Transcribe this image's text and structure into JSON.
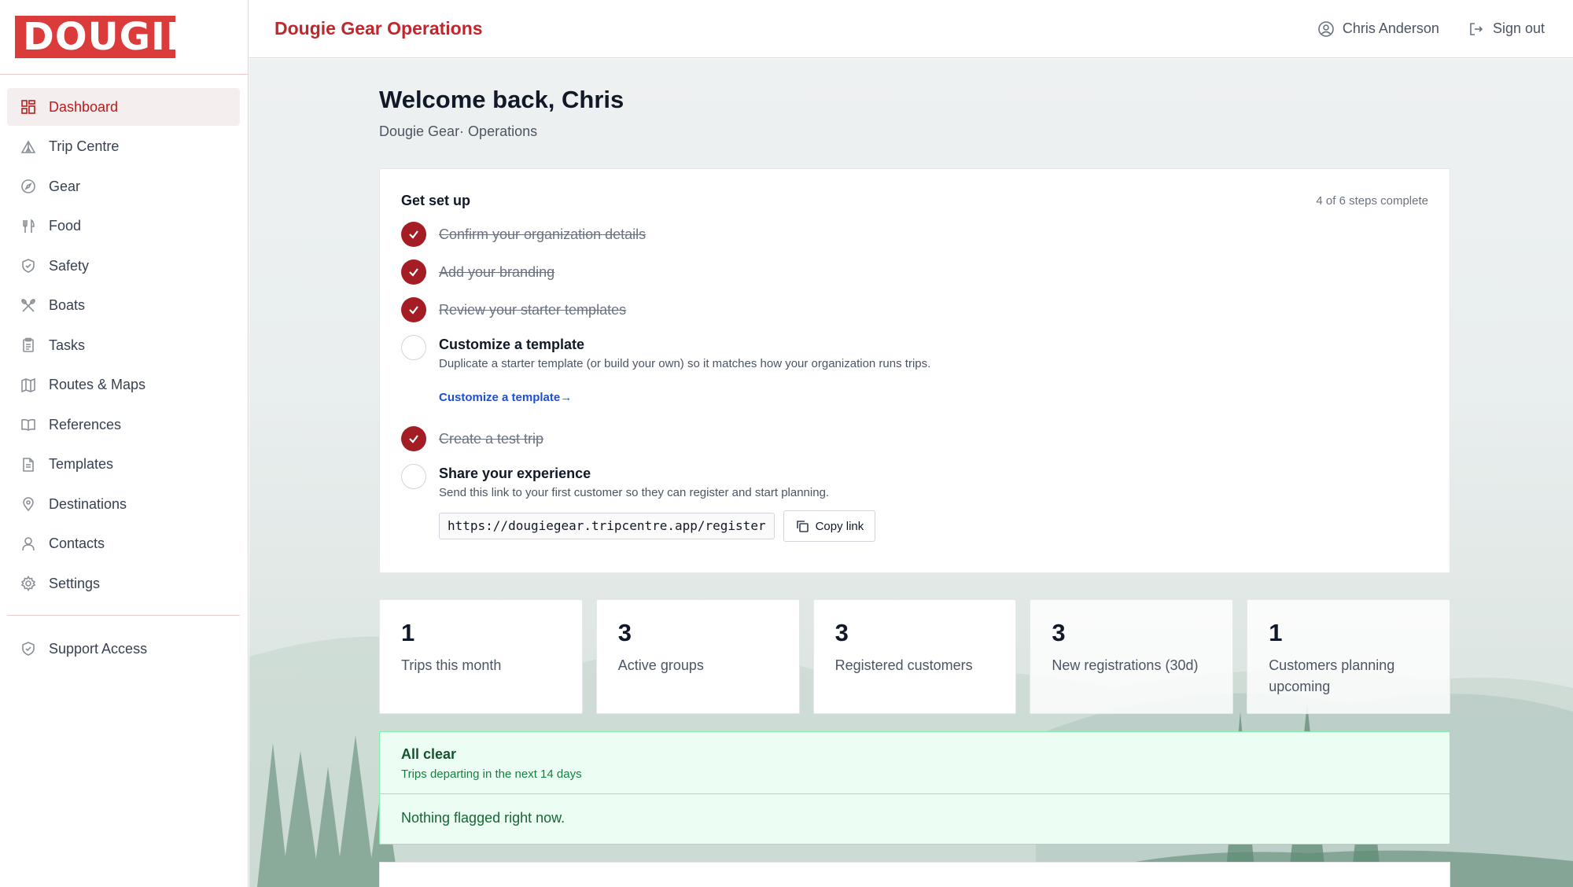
{
  "brand": {
    "logo_text": "DOUGIE",
    "accent": "#c0262b",
    "logo_bg": "#dc3b3b"
  },
  "sidebar": {
    "items": [
      {
        "label": "Dashboard",
        "icon": "dashboard-icon",
        "active": true
      },
      {
        "label": "Trip Centre",
        "icon": "tent-icon"
      },
      {
        "label": "Gear",
        "icon": "compass-icon"
      },
      {
        "label": "Food",
        "icon": "utensils-icon"
      },
      {
        "label": "Safety",
        "icon": "shield-icon"
      },
      {
        "label": "Boats",
        "icon": "paddles-icon"
      },
      {
        "label": "Tasks",
        "icon": "clipboard-icon"
      },
      {
        "label": "Routes & Maps",
        "icon": "map-icon"
      },
      {
        "label": "References",
        "icon": "book-icon"
      },
      {
        "label": "Templates",
        "icon": "document-icon"
      },
      {
        "label": "Destinations",
        "icon": "map-pin-icon"
      },
      {
        "label": "Contacts",
        "icon": "user-icon"
      },
      {
        "label": "Settings",
        "icon": "gear-icon"
      }
    ],
    "support": {
      "label": "Support Access",
      "icon": "shield-check-icon"
    }
  },
  "header": {
    "title": "Dougie Gear Operations",
    "user_name": "Chris Anderson",
    "sign_out": "Sign out"
  },
  "main": {
    "welcome": "Welcome back, Chris",
    "subtitle": "Dougie Gear· Operations"
  },
  "setup": {
    "title": "Get set up",
    "progress": "4 of 6 steps complete",
    "steps": [
      {
        "title": "Confirm your organization details",
        "done": true
      },
      {
        "title": "Add your branding",
        "done": true
      },
      {
        "title": "Review your starter templates",
        "done": true
      },
      {
        "title": "Customize a template",
        "done": false,
        "desc": "Duplicate a starter template (or build your own) so it matches how your organization runs trips.",
        "link": "Customize a template→"
      },
      {
        "title": "Create a test trip",
        "done": true
      },
      {
        "title": "Share your experience",
        "done": false,
        "desc": "Send this link to your first customer so they can register and start planning.",
        "url": "https://dougiegear.tripcentre.app/register",
        "button": "Copy link"
      }
    ]
  },
  "stats": [
    {
      "value": "1",
      "label": "Trips this month"
    },
    {
      "value": "3",
      "label": "Active groups"
    },
    {
      "value": "3",
      "label": "Registered customers"
    },
    {
      "value": "3",
      "label": "New registrations (30d)"
    },
    {
      "value": "1",
      "label": "Customers planning upcoming"
    }
  ],
  "alert": {
    "title": "All clear",
    "subtitle": "Trips departing in the next 14 days",
    "body": "Nothing flagged right now."
  }
}
